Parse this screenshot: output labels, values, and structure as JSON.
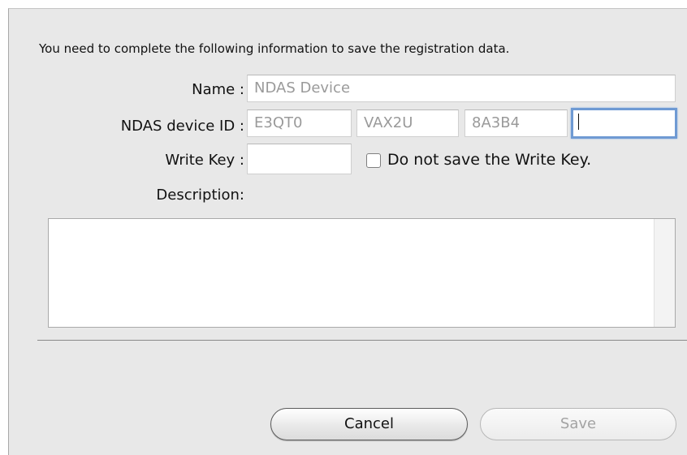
{
  "dialog": {
    "intro_text": "You need to complete the following information to save the registration data."
  },
  "form": {
    "name": {
      "label": "Name :",
      "placeholder": "NDAS Device",
      "value": ""
    },
    "device_id": {
      "label": "NDAS device ID :",
      "segments": [
        {
          "placeholder": "E3QT0",
          "value": ""
        },
        {
          "placeholder": "VAX2U",
          "value": ""
        },
        {
          "placeholder": "8A3B4",
          "value": ""
        },
        {
          "placeholder": "",
          "value": ""
        }
      ]
    },
    "write_key": {
      "label": "Write Key :",
      "value": "",
      "do_not_save": {
        "label": "Do not save the Write Key.",
        "checked": false
      }
    },
    "description": {
      "label": "Description:",
      "value": ""
    }
  },
  "buttons": {
    "cancel_label": "Cancel",
    "save_label": "Save",
    "save_enabled": false
  },
  "colors": {
    "focus_ring": "#6f9ad3",
    "placeholder_text": "#9a9a9a",
    "panel_background": "#e8e8e8"
  }
}
